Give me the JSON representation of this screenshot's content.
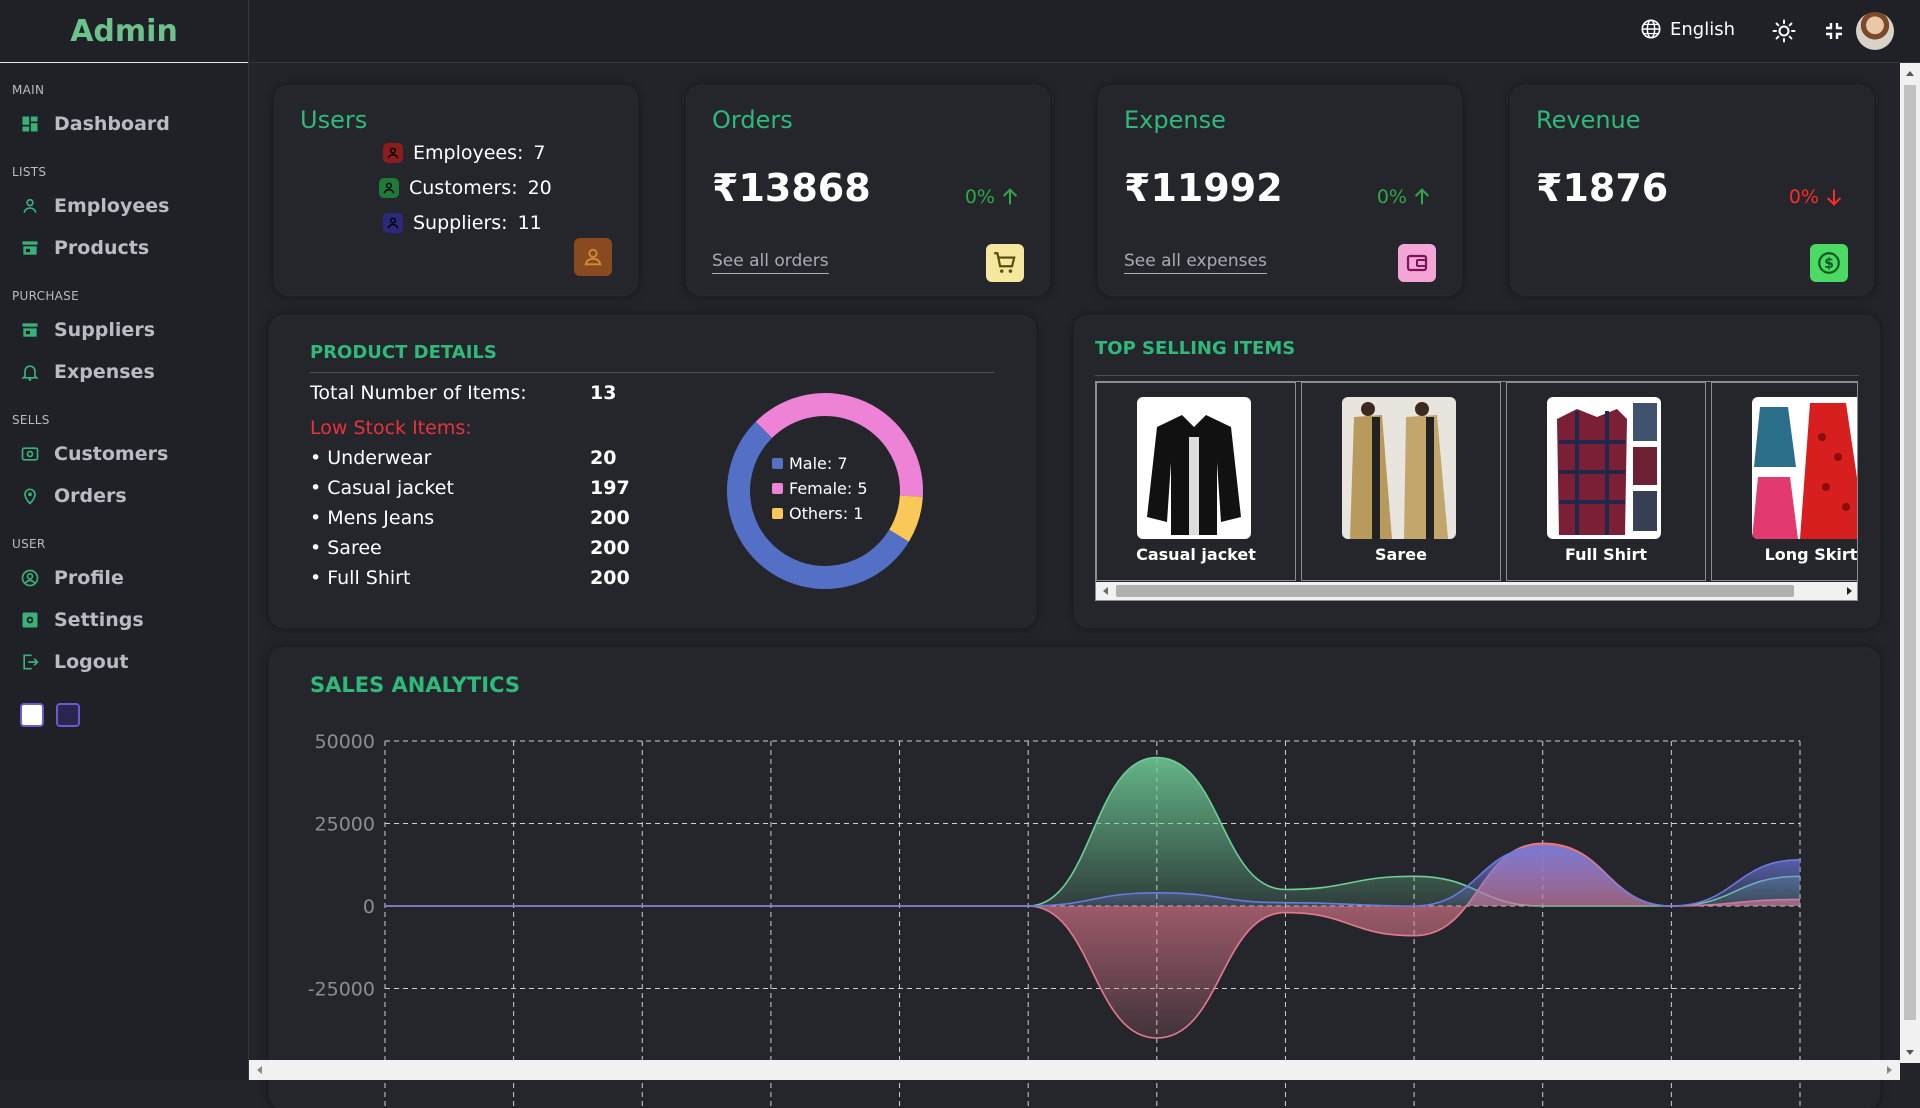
{
  "sidebar": {
    "brand": "Admin",
    "sections": [
      {
        "title": "MAIN",
        "items": [
          {
            "label": "Dashboard",
            "icon": "dashboard-icon"
          }
        ]
      },
      {
        "title": "LISTS",
        "items": [
          {
            "label": "Employees",
            "icon": "person-icon"
          },
          {
            "label": "Products",
            "icon": "store-icon"
          }
        ]
      },
      {
        "title": "PURCHASE",
        "items": [
          {
            "label": "Suppliers",
            "icon": "store-icon"
          },
          {
            "label": "Expenses",
            "icon": "bell-icon"
          }
        ]
      },
      {
        "title": "SELLS",
        "items": [
          {
            "label": "Customers",
            "icon": "card-icon"
          },
          {
            "label": "Orders",
            "icon": "location-icon"
          }
        ]
      },
      {
        "title": "USER",
        "items": [
          {
            "label": "Profile",
            "icon": "account-circle-icon"
          },
          {
            "label": "Settings",
            "icon": "settings-icon"
          },
          {
            "label": "Logout",
            "icon": "logout-icon"
          }
        ]
      }
    ],
    "theme_colors": [
      "#ffffff",
      "#2a2650"
    ]
  },
  "topbar": {
    "language": "English"
  },
  "cards": {
    "users": {
      "title": "Users",
      "rows": [
        {
          "label": "Employees:",
          "value": "7",
          "color": "#8b1d1d"
        },
        {
          "label": "Customers:",
          "value": "20",
          "color": "#1f7a3a"
        },
        {
          "label": "Suppliers:",
          "value": "11",
          "color": "#2b2a7a"
        }
      ]
    },
    "orders": {
      "title": "Orders",
      "amount": "₹13868",
      "pct": "0%",
      "trend": "up",
      "link": "See all orders",
      "icon_bg": "#f5e79e"
    },
    "expense": {
      "title": "Expense",
      "amount": "₹11992",
      "pct": "0%",
      "trend": "up",
      "link": "See all expenses",
      "icon_bg": "#f3a6d6"
    },
    "revenue": {
      "title": "Revenue",
      "amount": "₹1876",
      "pct": "0%",
      "trend": "down",
      "icon_bg": "#4cd964"
    }
  },
  "product_details": {
    "title": "PRODUCT DETAILS",
    "total_label": "Total Number of Items:",
    "total_value": "13",
    "low_stock_label": "Low Stock Items:",
    "items": [
      {
        "name": "• Underwear",
        "qty": "20"
      },
      {
        "name": "• Casual jacket",
        "qty": "197"
      },
      {
        "name": "• Mens Jeans",
        "qty": "200"
      },
      {
        "name": "• Saree",
        "qty": "200"
      },
      {
        "name": "• Full Shirt",
        "qty": "200"
      }
    ],
    "donut": [
      {
        "label": "Male:",
        "value": 7,
        "color": "#5470c6"
      },
      {
        "label": "Female:",
        "value": 5,
        "color": "#ee82d6"
      },
      {
        "label": "Others:",
        "value": 1,
        "color": "#fac858"
      }
    ]
  },
  "top_selling": {
    "title": "TOP SELLING ITEMS",
    "items": [
      "Casual jacket",
      "Saree",
      "Full Shirt",
      "Long Skirt"
    ]
  },
  "chart_data": {
    "type": "area",
    "title": "SALES ANALYTICS",
    "y_ticks": [
      "50000",
      "25000",
      "0",
      "-25000"
    ],
    "ylim": [
      -45000,
      50000
    ],
    "x": [
      0,
      1,
      2,
      3,
      4,
      5,
      6,
      7,
      8,
      9,
      10,
      11
    ],
    "grid": true,
    "series": [
      {
        "color": "#6fcf97",
        "values": [
          0,
          0,
          0,
          0,
          0,
          0,
          45000,
          5000,
          9000,
          0,
          0,
          9000
        ]
      },
      {
        "color": "#e57a8e",
        "values": [
          0,
          0,
          0,
          0,
          0,
          0,
          -40000,
          -2000,
          -9000,
          19000,
          0,
          2000
        ]
      },
      {
        "color": "#6c7ae0",
        "values": [
          0,
          0,
          0,
          0,
          0,
          0,
          4000,
          1000,
          0,
          18000,
          0,
          14000
        ]
      }
    ]
  }
}
